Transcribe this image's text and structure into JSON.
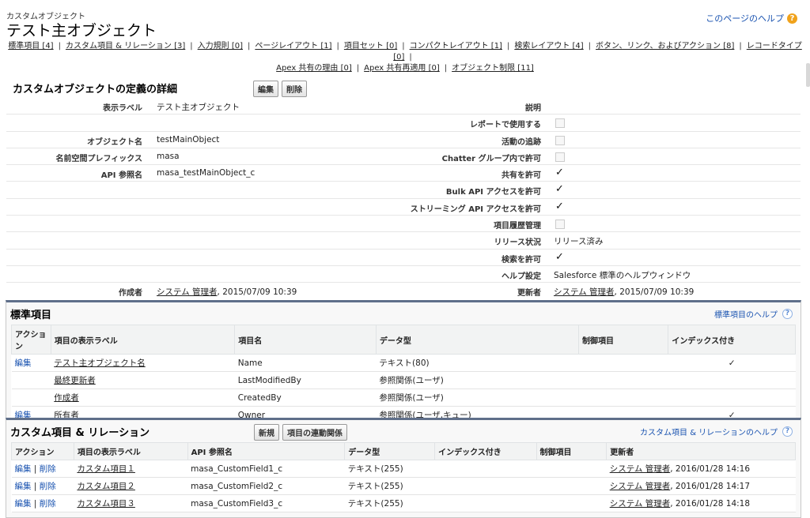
{
  "header": {
    "subtitle": "カスタムオブジェクト",
    "title": "テスト主オブジェクト",
    "help": "このページのヘルプ"
  },
  "relnav": [
    "標準項目 [4]",
    "カスタム項目 & リレーション [3]",
    "入力規則 [0]",
    "ページレイアウト [1]",
    "項目セット [0]",
    "コンパクトレイアウト [1]",
    "検索レイアウト [4]",
    "ボタン、リンク、およびアクション [8]",
    "レコードタイプ [0]",
    "Apex 共有の理由 [0]",
    "Apex 共有再適用 [0]",
    "オブジェクト制限 [11]"
  ],
  "detail": {
    "title": "カスタムオブジェクトの定義の詳細",
    "edit": "編集",
    "delete": "削除",
    "left": [
      {
        "label": "表示ラベル",
        "value": "テスト主オブジェクト"
      },
      {
        "label": "",
        "value": ""
      },
      {
        "label": "オブジェクト名",
        "value": "testMainObject"
      },
      {
        "label": "名前空間プレフィックス",
        "value": "masa"
      },
      {
        "label": "API 参照名",
        "value": "masa_testMainObject_c"
      },
      {
        "label": "",
        "value": ""
      },
      {
        "label": "",
        "value": ""
      },
      {
        "label": "",
        "value": ""
      },
      {
        "label": "",
        "value": ""
      },
      {
        "label": "",
        "value": ""
      },
      {
        "label": "",
        "value": ""
      },
      {
        "label": "作成者",
        "value": "システム 管理者",
        "date": ", 2015/07/09 10:39"
      }
    ],
    "right": [
      {
        "label": "説明",
        "kind": "text",
        "value": ""
      },
      {
        "label": "レポートで使用する",
        "kind": "box"
      },
      {
        "label": "活動の追跡",
        "kind": "box"
      },
      {
        "label": "Chatter グループ内で許可",
        "kind": "box"
      },
      {
        "label": "共有を許可",
        "kind": "check",
        "value": "✓"
      },
      {
        "label": "Bulk API アクセスを許可",
        "kind": "check",
        "value": "✓"
      },
      {
        "label": "ストリーミング API アクセスを許可",
        "kind": "check",
        "value": "✓"
      },
      {
        "label": "項目履歴管理",
        "kind": "box"
      },
      {
        "label": "リリース状況",
        "kind": "text",
        "value": "リリース済み"
      },
      {
        "label": "検索を許可",
        "kind": "check",
        "value": "✓"
      },
      {
        "label": "ヘルプ設定",
        "kind": "text",
        "value": "Salesforce 標準のヘルプウィンドウ"
      },
      {
        "label": "更新者",
        "kind": "user",
        "value": "システム 管理者",
        "date": ", 2015/07/09 10:39"
      }
    ]
  },
  "standard_fields": {
    "title": "標準項目",
    "help": "標準項目のヘルプ",
    "columns": [
      "アクション",
      "項目の表示ラベル",
      "項目名",
      "データ型",
      "制御項目",
      "インデックス付き"
    ],
    "rows": [
      {
        "action": "編集",
        "label": "テスト主オブジェクト名",
        "name": "Name",
        "type": "テキスト(80)",
        "ctrl": "",
        "indexed": "✓"
      },
      {
        "action": "",
        "label": "最終更新者",
        "name": "LastModifiedBy",
        "type": "参照関係(ユーザ)",
        "ctrl": "",
        "indexed": ""
      },
      {
        "action": "",
        "label": "作成者",
        "name": "CreatedBy",
        "type": "参照関係(ユーザ)",
        "ctrl": "",
        "indexed": ""
      },
      {
        "action": "編集",
        "label": "所有者",
        "name": "Owner",
        "type": "参照関係(ユーザ,キュー)",
        "ctrl": "",
        "indexed": "✓"
      }
    ]
  },
  "custom_fields": {
    "title": "カスタム項目 & リレーション",
    "new_btn": "新規",
    "dep_btn": "項目の連動関係",
    "help": "カスタム項目 & リレーションのヘルプ",
    "columns": [
      "アクション",
      "項目の表示ラベル",
      "API 参照名",
      "データ型",
      "インデックス付き",
      "制御項目",
      "更新者"
    ],
    "rows": [
      {
        "edit": "編集",
        "del": "削除",
        "label": "カスタム項目１",
        "api": "masa_CustomField1_c",
        "type": "テキスト(255)",
        "user": "システム 管理者",
        "date": ", 2016/01/28 14:16"
      },
      {
        "edit": "編集",
        "del": "削除",
        "label": "カスタム項目２",
        "api": "masa_CustomField2_c",
        "type": "テキスト(255)",
        "user": "システム 管理者",
        "date": ", 2016/01/28 14:17"
      },
      {
        "edit": "編集",
        "del": "削除",
        "label": "カスタム項目３",
        "api": "masa_CustomField3_c",
        "type": "テキスト(255)",
        "user": "システム 管理者",
        "date": ", 2016/01/28 14:18"
      }
    ]
  }
}
